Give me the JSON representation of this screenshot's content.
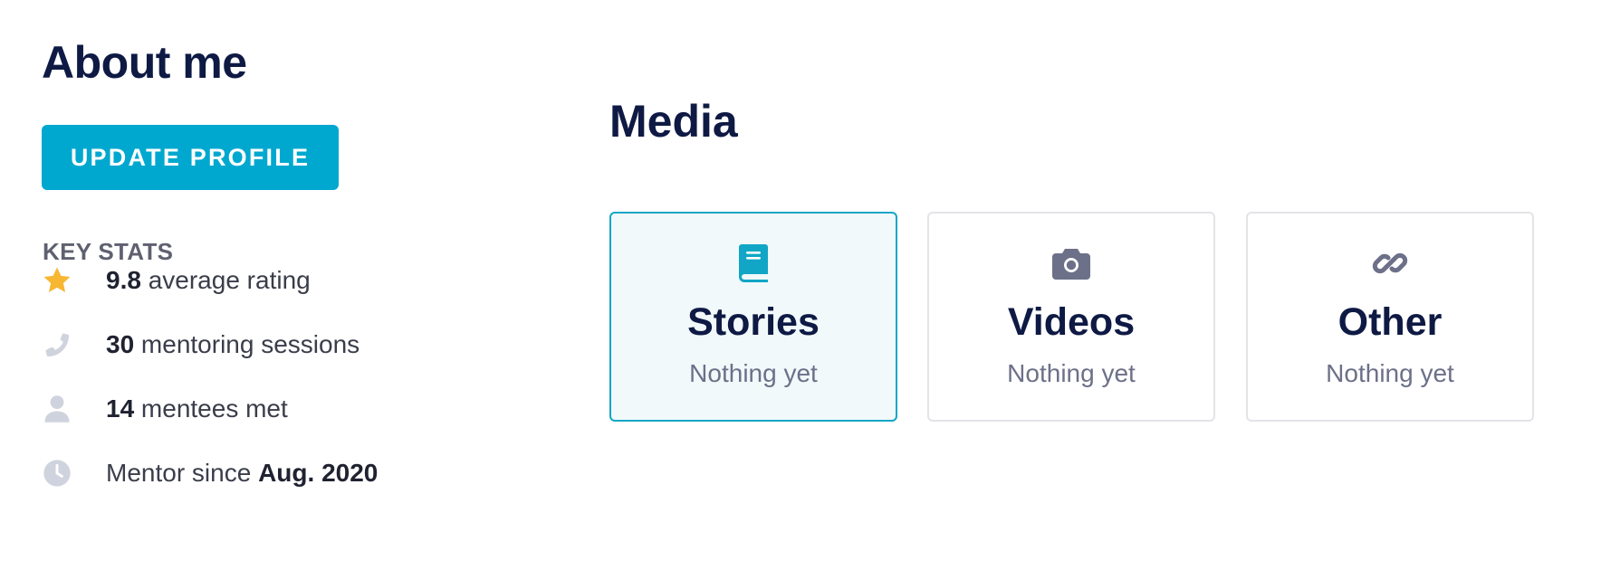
{
  "about": {
    "title": "About me",
    "update_button": "UPDATE PROFILE"
  },
  "key_stats": {
    "title": "KEY STATS",
    "items": [
      {
        "icon": "star-icon",
        "value": "9.8",
        "label": " average rating"
      },
      {
        "icon": "phone-icon",
        "value": "30",
        "label": " mentoring sessions"
      },
      {
        "icon": "user-icon",
        "value": "14",
        "label": " mentees met"
      },
      {
        "icon": "clock-icon",
        "prefix": "Mentor since ",
        "value": "Aug. 2020"
      }
    ]
  },
  "media": {
    "title": "Media",
    "cards": [
      {
        "icon": "book-icon",
        "title": "Stories",
        "subtitle": "Nothing yet",
        "active": true
      },
      {
        "icon": "camera-icon",
        "title": "Videos",
        "subtitle": "Nothing yet",
        "active": false
      },
      {
        "icon": "link-icon",
        "title": "Other",
        "subtitle": "Nothing yet",
        "active": false
      }
    ]
  },
  "colors": {
    "accent": "#00a8cf",
    "heading": "#0e1a44",
    "star": "#f7b733",
    "muted_icon": "#cfd3de"
  }
}
